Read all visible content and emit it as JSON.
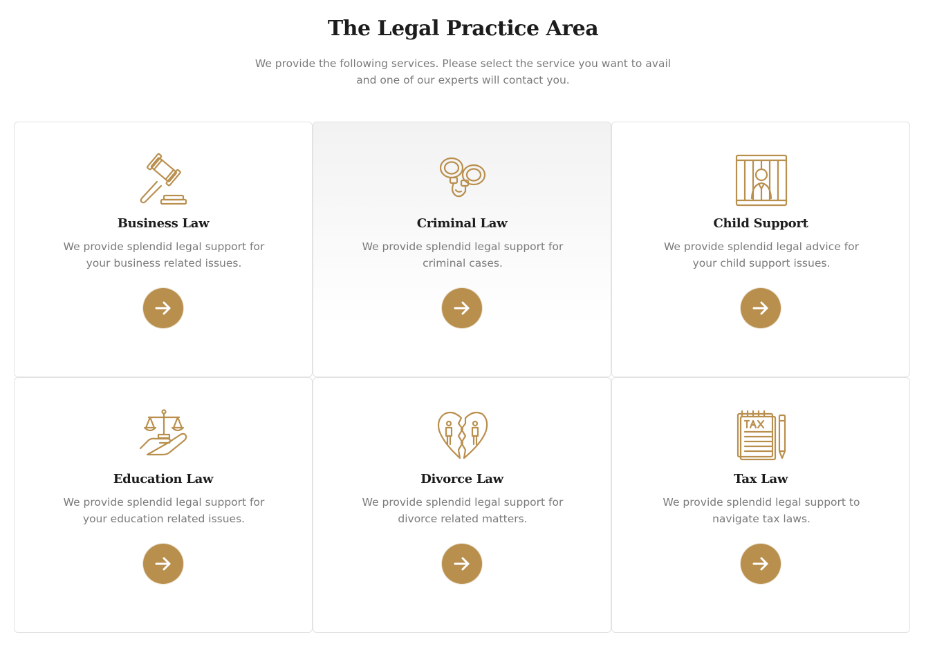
{
  "header": {
    "title": "The Legal Practice Area",
    "subtitle": "We provide the following services. Please select the service you want to avail and one of our experts will contact you."
  },
  "colors": {
    "accent": "#b98f4e",
    "title": "#1c1c1c",
    "body_text": "#7a7a7a",
    "card_border": "#e2e2e2"
  },
  "services": [
    {
      "title": "Business Law",
      "description": "We provide splendid legal support for your business related issues.",
      "icon": "gavel-icon",
      "active": false
    },
    {
      "title": "Criminal Law",
      "description": "We provide splendid legal support for criminal cases.",
      "icon": "handcuffs-icon",
      "active": true
    },
    {
      "title": "Child Support",
      "description": "We provide splendid legal advice for your child support issues.",
      "icon": "prison-bars-icon",
      "active": false
    },
    {
      "title": "Education Law",
      "description": "We provide splendid legal support for your education related issues.",
      "icon": "scales-hand-icon",
      "active": false
    },
    {
      "title": "Divorce Law",
      "description": "We provide splendid legal support for divorce related matters.",
      "icon": "broken-heart-icon",
      "active": false
    },
    {
      "title": "Tax Law",
      "description": "We provide splendid legal support to navigate tax laws.",
      "icon": "tax-document-icon",
      "active": false
    }
  ]
}
